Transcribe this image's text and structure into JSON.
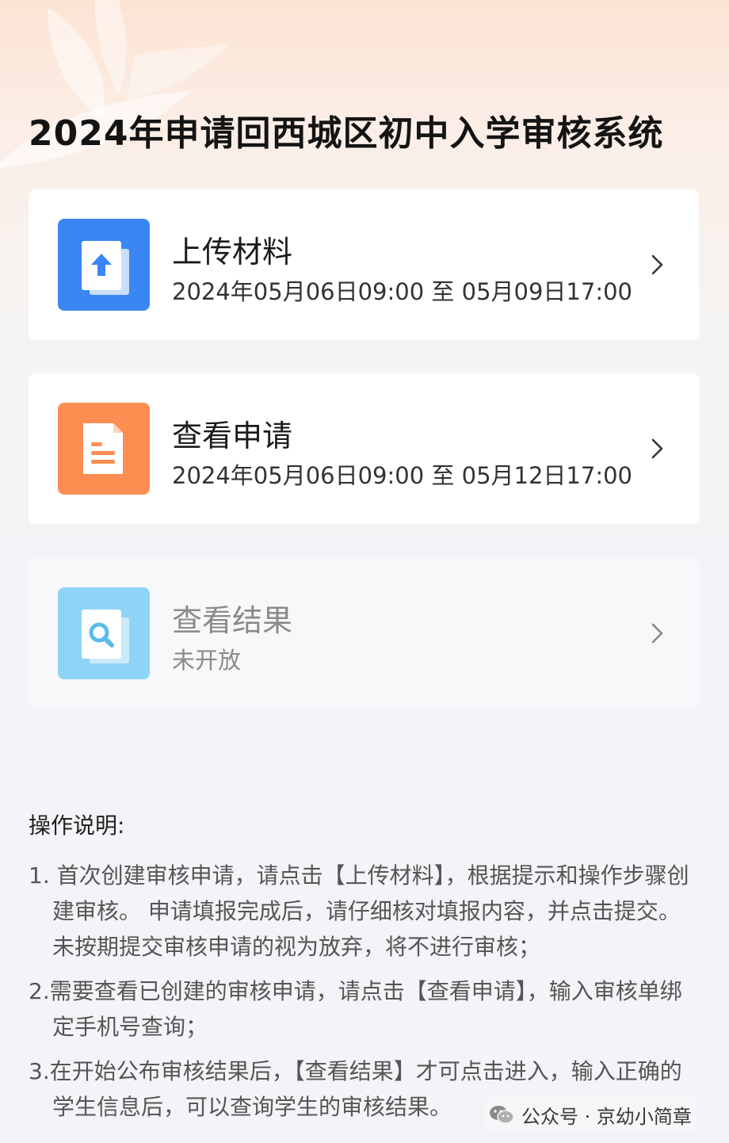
{
  "page": {
    "title": "2024年申请回西城区初中入学审核系统"
  },
  "cards": [
    {
      "title": "上传材料",
      "subtitle": "2024年05月06日09:00 至 05月09日17:00",
      "icon": "upload-icon",
      "icon_color": "#3b86f5",
      "enabled": true
    },
    {
      "title": "查看申请",
      "subtitle": "2024年05月06日09:00 至 05月12日17:00",
      "icon": "document-icon",
      "icon_color": "#fe8d52",
      "enabled": true
    },
    {
      "title": "查看结果",
      "subtitle": "未开放",
      "icon": "search-icon",
      "icon_color": "#8fd4f6",
      "enabled": false
    }
  ],
  "instructions": {
    "title": "操作说明:",
    "items": [
      "1. 首次创建审核申请，请点击【上传材料】，根据提示和操作步骤创建审核。 申请填报完成后，请仔细核对填报内容，并点击提交。未按期提交审核申请的视为放弃，将不进行审核；",
      "2.需要查看已创建的审核申请，请点击【查看申请】，输入审核单绑定手机号查询；",
      "3.在开始公布审核结果后，【查看结果】才可点击进入，输入正确的学生信息后，可以查询学生的审核结果。"
    ]
  },
  "watermark": {
    "text": "公众号 · 京幼小简章",
    "icon": "wechat-icon"
  }
}
